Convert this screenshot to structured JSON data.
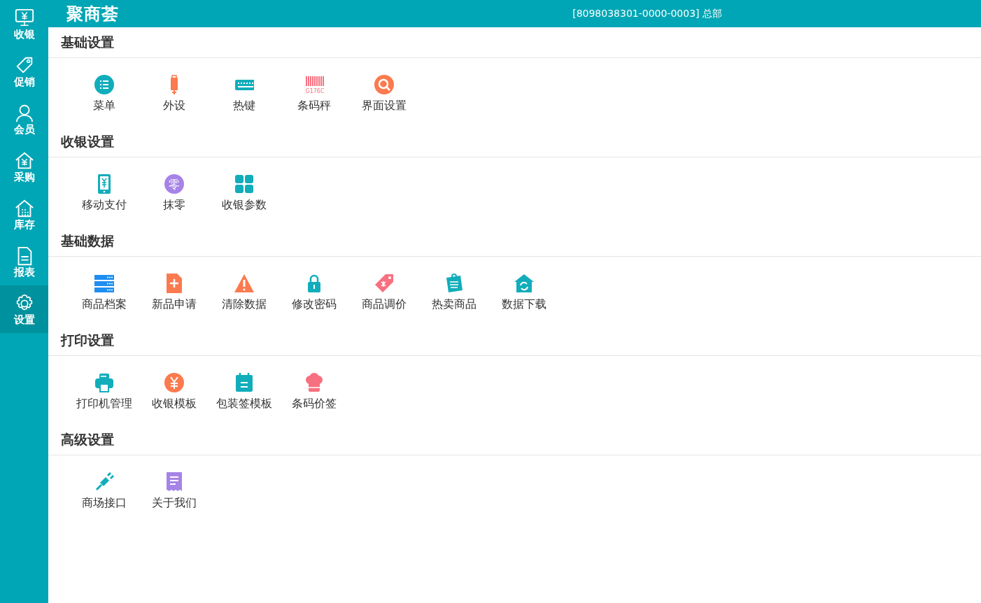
{
  "sidebar": {
    "items": [
      {
        "label": "收银",
        "kind": "monitor",
        "selected": false
      },
      {
        "label": "促销",
        "kind": "tag",
        "selected": false
      },
      {
        "label": "会员",
        "kind": "person",
        "selected": false
      },
      {
        "label": "采购",
        "kind": "house-yen",
        "selected": false
      },
      {
        "label": "库存",
        "kind": "warehouse",
        "selected": false
      },
      {
        "label": "报表",
        "kind": "document",
        "selected": false
      },
      {
        "label": "设置",
        "kind": "gear",
        "selected": true
      }
    ]
  },
  "header": {
    "logo": "聚商荟",
    "store": "[8098038301-0000-0003] 总部"
  },
  "sections": [
    {
      "title": "基础设置",
      "items": [
        {
          "label": "菜单",
          "kind": "list"
        },
        {
          "label": "外设",
          "kind": "usb"
        },
        {
          "label": "热键",
          "kind": "keyboard"
        },
        {
          "label": "条码秤",
          "kind": "barcode",
          "icon_text": "G176C"
        },
        {
          "label": "界面设置",
          "kind": "magnifier"
        }
      ]
    },
    {
      "title": "收银设置",
      "items": [
        {
          "label": "移动支付",
          "kind": "phone"
        },
        {
          "label": "抹零",
          "kind": "zero",
          "icon_text": "零"
        },
        {
          "label": "收银参数",
          "kind": "grid"
        }
      ]
    },
    {
      "title": "基础数据",
      "items": [
        {
          "label": "商品档案",
          "kind": "server"
        },
        {
          "label": "新品申请",
          "kind": "file-plus"
        },
        {
          "label": "清除数据",
          "kind": "warning"
        },
        {
          "label": "修改密码",
          "kind": "lock"
        },
        {
          "label": "商品调价",
          "kind": "price-tag"
        },
        {
          "label": "热卖商品",
          "kind": "note"
        },
        {
          "label": "数据下载",
          "kind": "home-sync"
        }
      ]
    },
    {
      "title": "打印设置",
      "items": [
        {
          "label": "打印机管理",
          "kind": "printer"
        },
        {
          "label": "收银模板",
          "kind": "coin"
        },
        {
          "label": "包装签模板",
          "kind": "calendar"
        },
        {
          "label": "条码价签",
          "kind": "chef-hat"
        }
      ]
    },
    {
      "title": "高级设置",
      "items": [
        {
          "label": "商场接口",
          "kind": "plug"
        },
        {
          "label": "关于我们",
          "kind": "receipt"
        }
      ]
    }
  ]
}
